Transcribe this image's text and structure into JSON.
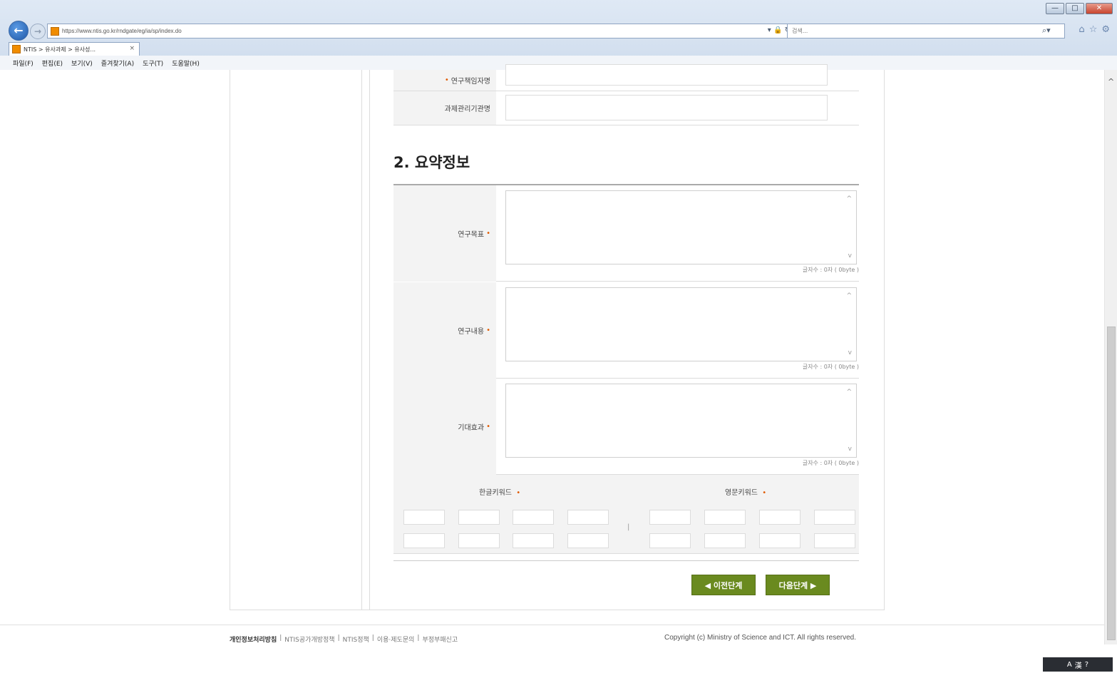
{
  "browser": {
    "url": "https://www.ntis.go.kr/rndgate/eg/ia/sp/index.do",
    "search_placeholder": "검색...",
    "tab_title": "NTIS > 유사과제 > 유사성...",
    "window_controls": {
      "minimize": "—",
      "maximize": "□",
      "close": "✕"
    },
    "menu": [
      "파일(F)",
      "편집(E)",
      "보기(V)",
      "즐겨찾기(A)",
      "도구(T)",
      "도움말(H)"
    ]
  },
  "form_top": {
    "row1_label": "연구책임자명",
    "row2_label": "과제관리기관명"
  },
  "section": {
    "title": "2. 요약정보"
  },
  "summary_fields": [
    {
      "label": "연구목표",
      "char_count": "글자수 : 0자 ( 0byte )"
    },
    {
      "label": "연구내용",
      "char_count": "글자수 : 0자 ( 0byte )"
    },
    {
      "label": "기대효과",
      "char_count": "글자수 : 0자 ( 0byte )"
    }
  ],
  "keywords": {
    "korean_label": "한글키워드",
    "english_label": "영문키워드",
    "separator": "|"
  },
  "buttons": {
    "prev": "◀ 이전단계",
    "next": "다음단계 ▶"
  },
  "footer": {
    "links": [
      "개인정보처리방침",
      "NTIS공가개방정책",
      "NTIS정책",
      "이용·제도문의",
      "부정부패신고"
    ],
    "copyright": "Copyright (c) Ministry of Science and ICT. All rights reserved."
  },
  "required_mark": "•",
  "colors": {
    "button_green": "#6a8a1f",
    "required_orange": "#e05a00"
  }
}
